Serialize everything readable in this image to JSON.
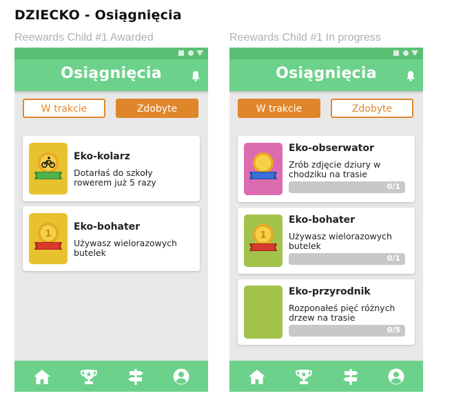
{
  "page": {
    "title": "DZIECKO - Osiągnięcia"
  },
  "colors": {
    "green": "#6cd18b",
    "orange": "#e0862a",
    "gray_bar": "#c8c8c8"
  },
  "frames": [
    {
      "label": "Reewards Child #1 Awarded",
      "header_title": "Osiągnięcia",
      "tabs": [
        {
          "label": "W trakcie",
          "active": false
        },
        {
          "label": "Zdobyte",
          "active": true
        }
      ],
      "cards": [
        {
          "title": "Eko-kolarz",
          "desc_lines": [
            "Dotarłaś do szkoły",
            "rowerem już 5 razy"
          ],
          "icon": "bicycle-medal-icon"
        },
        {
          "title": "Eko-bohater",
          "desc_lines": [
            "Używasz wielorazowych",
            "butelek"
          ],
          "icon": "number-one-medal-icon"
        }
      ]
    },
    {
      "label": "Reewards Child #1 In progress",
      "header_title": "Osiągnięcia",
      "tabs": [
        {
          "label": "W trakcie",
          "active": true
        },
        {
          "label": "Zdobyte",
          "active": false
        }
      ],
      "cards": [
        {
          "title": "Eko-obserwator",
          "desc_lines": [
            "Zrób zdjęcie dziury w",
            "chodziku na trasie"
          ],
          "progress": "0/1",
          "icon": "blank-medal-icon"
        },
        {
          "title": "Eko-bohater",
          "desc_lines": [
            "Używasz wielorazowych",
            "butelek"
          ],
          "progress": "0/1",
          "icon": "number-one-medal-icon"
        },
        {
          "title": "Eko-przyrodnik",
          "desc_lines": [
            "Rozponałeś pięć różnych",
            "drzew na trasie"
          ],
          "progress": "0/5",
          "icon": "empty-badge"
        }
      ]
    }
  ],
  "nav": {
    "icons": [
      "home-icon",
      "trophy-icon",
      "signpost-icon",
      "profile-icon"
    ]
  }
}
